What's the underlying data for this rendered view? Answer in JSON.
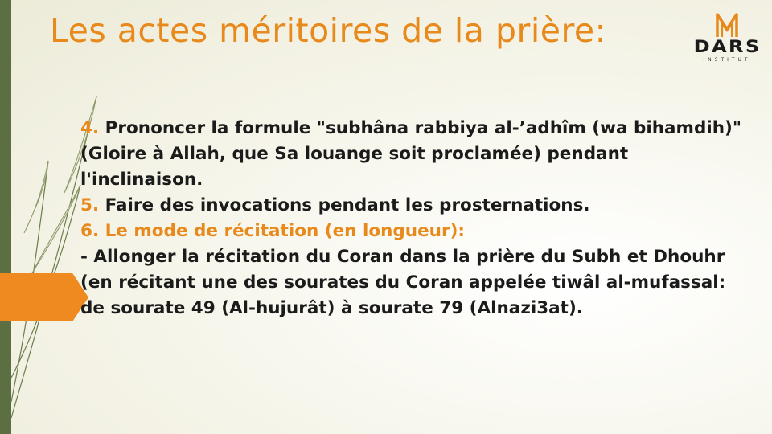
{
  "slide": {
    "title": "Les actes méritoires de la prière:",
    "logo": {
      "name": "DARS",
      "subtitle": "INSTITUT"
    },
    "items": [
      {
        "num": "4.",
        "text": " Prononcer la formule \"subhâna rabbiya al-’adhîm (wa bihamdih)\" (Gloire à Allah, que Sa louange soit proclamée) pendant l'inclinaison."
      },
      {
        "num": "5.",
        "text": " Faire des invocations pendant les prosternations."
      },
      {
        "heading": "6. Le mode de récitation (en longueur):"
      },
      {
        "text": "- Allonger la récitation du Coran dans la prière du Subh et Dhouhr (en récitant une des sourates du Coran appelée tiwâl al-mufassal: de sourate 49 (Al-hujurât) à sourate 79 (Alnazi3at)."
      }
    ]
  },
  "colors": {
    "accent": "#e8891c",
    "sidebar": "#5c6f43",
    "text": "#1b1b1b"
  }
}
